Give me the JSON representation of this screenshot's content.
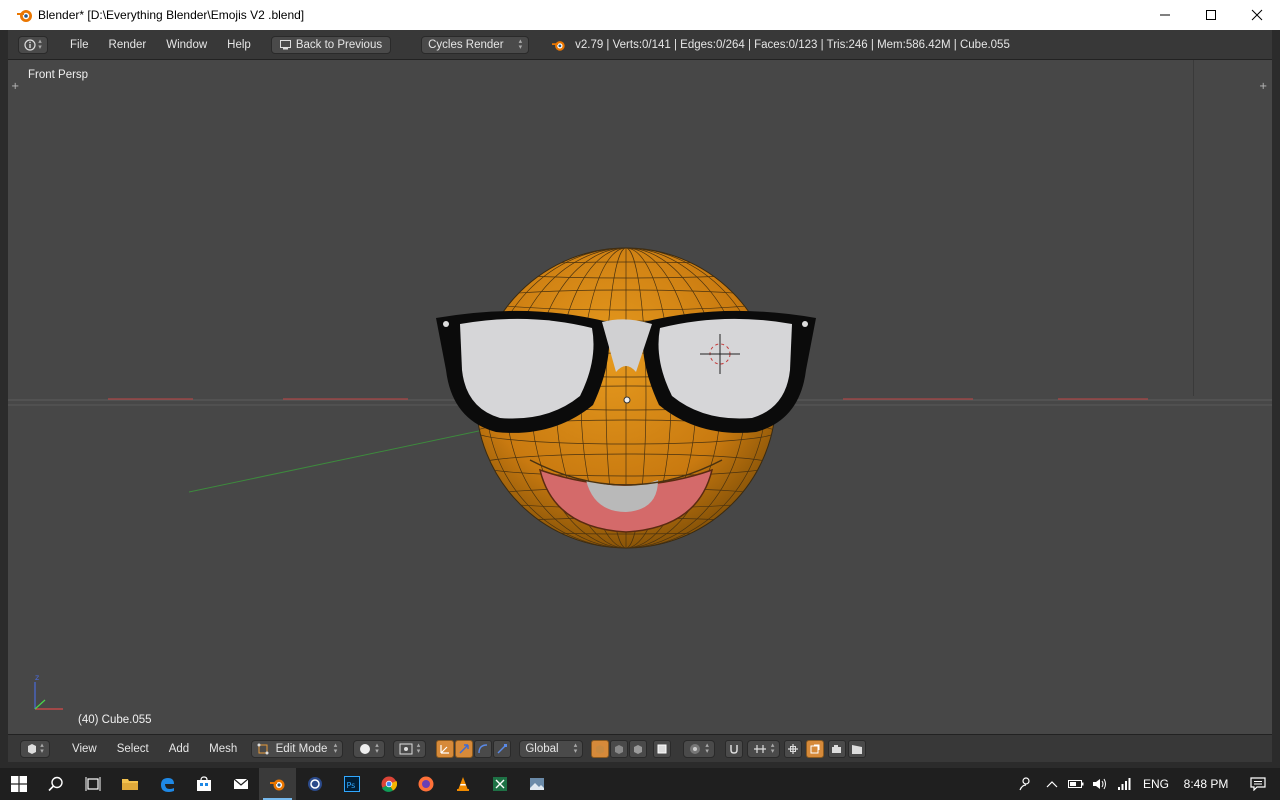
{
  "window": {
    "title": "Blender* [D:\\Everything Blender\\Emojis V2 .blend]"
  },
  "infobar": {
    "menus": [
      "File",
      "Render",
      "Window",
      "Help"
    ],
    "back_label": "Back to Previous",
    "engine": "Cycles Render",
    "stats": "v2.79 | Verts:0/141 | Edges:0/264 | Faces:0/123 | Tris:246 | Mem:586.42M | Cube.055"
  },
  "viewport": {
    "view_label": "Front Persp",
    "object_label": "(40) Cube.055"
  },
  "bottombar": {
    "menus": [
      "View",
      "Select",
      "Add",
      "Mesh"
    ],
    "mode": "Edit Mode",
    "orientation": "Global"
  },
  "taskbar": {
    "language": "ENG",
    "time": "8:48 PM"
  },
  "colors": {
    "accent": "#d68a3a",
    "viewport_bg": "#474747",
    "header_bg": "#383838"
  }
}
